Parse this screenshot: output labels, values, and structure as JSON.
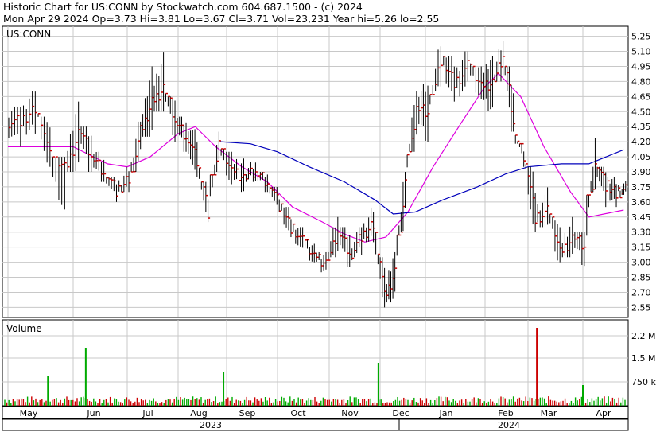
{
  "header": {
    "line1": "Historic Chart for US:CONN by Stockwatch.com 604.687.1500 - (c) 2024",
    "line2": "Mon Apr 29 2024  Op=3.73  Hi=3.81  Lo=3.67  Cl=3.71  Vol=23,231  Year hi=5.26  lo=2.55"
  },
  "price_panel_label": "US:CONN",
  "volume_panel_label": "Volume",
  "chart_data": [
    {
      "type": "bar",
      "subtype": "ohlc",
      "series": [
        {
          "values": [
            {
              "m": "May",
              "d": 1,
              "hi": 4.55,
              "lo": 4.1,
              "c": 4.4
            },
            {
              "m": "May",
              "d": 8,
              "hi": 4.7,
              "lo": 4.25,
              "c": 4.55
            },
            {
              "m": "May",
              "d": 15,
              "hi": 4.45,
              "lo": 3.95,
              "c": 4.05
            },
            {
              "m": "May",
              "d": 22,
              "hi": 4.05,
              "lo": 3.05,
              "c": 3.95
            },
            {
              "m": "May",
              "d": 29,
              "hi": 4.6,
              "lo": 3.9,
              "c": 4.3
            },
            {
              "m": "Jun",
              "d": 5,
              "hi": 4.35,
              "lo": 3.9,
              "c": 4.05
            },
            {
              "m": "Jun",
              "d": 12,
              "hi": 4.1,
              "lo": 3.8,
              "c": 3.9
            },
            {
              "m": "Jun",
              "d": 19,
              "hi": 3.85,
              "lo": 3.6,
              "c": 3.7
            },
            {
              "m": "Jun",
              "d": 26,
              "hi": 3.95,
              "lo": 3.7,
              "c": 3.85
            },
            {
              "m": "Jul",
              "d": 3,
              "hi": 4.4,
              "lo": 3.9,
              "c": 4.3
            },
            {
              "m": "Jul",
              "d": 10,
              "hi": 4.95,
              "lo": 4.25,
              "c": 4.6
            },
            {
              "m": "Jul",
              "d": 17,
              "hi": 5.2,
              "lo": 4.5,
              "c": 4.75
            },
            {
              "m": "Jul",
              "d": 24,
              "hi": 4.65,
              "lo": 4.2,
              "c": 4.4
            },
            {
              "m": "Jul",
              "d": 31,
              "hi": 4.45,
              "lo": 4.1,
              "c": 4.25
            },
            {
              "m": "Aug",
              "d": 7,
              "hi": 4.35,
              "lo": 3.85,
              "c": 4.0
            },
            {
              "m": "Aug",
              "d": 14,
              "hi": 3.8,
              "lo": 3.4,
              "c": 3.5
            },
            {
              "m": "Aug",
              "d": 21,
              "hi": 4.3,
              "lo": 3.9,
              "c": 4.15
            },
            {
              "m": "Aug",
              "d": 28,
              "hi": 4.1,
              "lo": 3.75,
              "c": 3.9
            },
            {
              "m": "Sep",
              "d": 5,
              "hi": 4.05,
              "lo": 3.7,
              "c": 3.85
            },
            {
              "m": "Sep",
              "d": 12,
              "hi": 4.0,
              "lo": 3.8,
              "c": 3.9
            },
            {
              "m": "Sep",
              "d": 19,
              "hi": 3.9,
              "lo": 3.7,
              "c": 3.8
            },
            {
              "m": "Sep",
              "d": 26,
              "hi": 3.75,
              "lo": 3.5,
              "c": 3.55
            },
            {
              "m": "Oct",
              "d": 3,
              "hi": 3.55,
              "lo": 3.25,
              "c": 3.35
            },
            {
              "m": "Oct",
              "d": 10,
              "hi": 3.35,
              "lo": 3.1,
              "c": 3.2
            },
            {
              "m": "Oct",
              "d": 17,
              "hi": 3.2,
              "lo": 3.0,
              "c": 3.05
            },
            {
              "m": "Oct",
              "d": 24,
              "hi": 3.1,
              "lo": 2.9,
              "c": 3.0
            },
            {
              "m": "Oct",
              "d": 31,
              "hi": 3.45,
              "lo": 3.05,
              "c": 3.3
            },
            {
              "m": "Nov",
              "d": 7,
              "hi": 3.35,
              "lo": 2.95,
              "c": 3.1
            },
            {
              "m": "Nov",
              "d": 14,
              "hi": 3.35,
              "lo": 3.05,
              "c": 3.25
            },
            {
              "m": "Nov",
              "d": 21,
              "hi": 3.55,
              "lo": 3.2,
              "c": 3.4
            },
            {
              "m": "Nov",
              "d": 28,
              "hi": 3.05,
              "lo": 2.55,
              "c": 2.65
            },
            {
              "m": "Dec",
              "d": 5,
              "hi": 3.1,
              "lo": 2.6,
              "c": 2.9
            },
            {
              "m": "Dec",
              "d": 12,
              "hi": 3.9,
              "lo": 3.3,
              "c": 3.8
            },
            {
              "m": "Dec",
              "d": 19,
              "hi": 4.7,
              "lo": 4.1,
              "c": 4.55
            },
            {
              "m": "Dec",
              "d": 27,
              "hi": 4.8,
              "lo": 4.2,
              "c": 4.5
            },
            {
              "m": "Jan",
              "d": 3,
              "hi": 5.15,
              "lo": 4.7,
              "c": 5.0
            },
            {
              "m": "Jan",
              "d": 10,
              "hi": 5.05,
              "lo": 4.6,
              "c": 4.8
            },
            {
              "m": "Jan",
              "d": 17,
              "hi": 5.1,
              "lo": 4.65,
              "c": 4.95
            },
            {
              "m": "Jan",
              "d": 24,
              "hi": 4.95,
              "lo": 4.6,
              "c": 4.75
            },
            {
              "m": "Jan",
              "d": 31,
              "hi": 5.05,
              "lo": 4.45,
              "c": 4.8
            },
            {
              "m": "Feb",
              "d": 7,
              "hi": 5.2,
              "lo": 4.8,
              "c": 5.05
            },
            {
              "m": "Feb",
              "d": 14,
              "hi": 4.95,
              "lo": 4.3,
              "c": 4.4
            },
            {
              "m": "Feb",
              "d": 21,
              "hi": 4.15,
              "lo": 3.95,
              "c": 4.05
            },
            {
              "m": "Feb",
              "d": 28,
              "hi": 3.95,
              "lo": 3.3,
              "c": 3.45
            },
            {
              "m": "Mar",
              "d": 6,
              "hi": 3.75,
              "lo": 3.35,
              "c": 3.5
            },
            {
              "m": "Mar",
              "d": 13,
              "hi": 3.45,
              "lo": 3.0,
              "c": 3.1
            },
            {
              "m": "Mar",
              "d": 20,
              "hi": 3.45,
              "lo": 3.05,
              "c": 3.25
            },
            {
              "m": "Mar",
              "d": 27,
              "hi": 3.3,
              "lo": 2.9,
              "c": 3.15
            },
            {
              "m": "Apr",
              "d": 3,
              "hi": 4.25,
              "lo": 3.7,
              "c": 4.0
            },
            {
              "m": "Apr",
              "d": 10,
              "hi": 3.95,
              "lo": 3.55,
              "c": 3.75
            },
            {
              "m": "Apr",
              "d": 17,
              "hi": 3.85,
              "lo": 3.55,
              "c": 3.7
            },
            {
              "m": "Apr",
              "d": 24,
              "hi": 3.81,
              "lo": 3.67,
              "c": 3.71
            }
          ]
        }
      ],
      "y_ticks": [
        5.25,
        5.1,
        4.95,
        4.8,
        4.65,
        4.5,
        4.35,
        4.2,
        4.05,
        3.9,
        3.75,
        3.6,
        3.45,
        3.3,
        3.15,
        3.0,
        2.85,
        2.7,
        2.55
      ],
      "y_tick_labels": [
        "5.25",
        "5.10",
        "4.95",
        "4.80",
        "4.65",
        "4.50",
        "4.35",
        "4.20",
        "4.05",
        "3.90",
        "3.75",
        "3.60",
        "3.45",
        "3.30",
        "3.15",
        "3.00",
        "2.85",
        "2.70",
        "2.55"
      ],
      "ylim": [
        2.45,
        5.35
      ],
      "grid": true,
      "moving_average_1": [
        {
          "m": "May",
          "d": 1,
          "v": 4.15
        },
        {
          "m": "Jun",
          "d": 1,
          "v": 4.15
        },
        {
          "m": "Jun",
          "d": 20,
          "v": 3.98
        },
        {
          "m": "Jul",
          "d": 1,
          "v": 3.95
        },
        {
          "m": "Jul",
          "d": 15,
          "v": 4.05
        },
        {
          "m": "Aug",
          "d": 1,
          "v": 4.28
        },
        {
          "m": "Aug",
          "d": 12,
          "v": 4.35
        },
        {
          "m": "Aug",
          "d": 25,
          "v": 4.15
        },
        {
          "m": "Sep",
          "d": 10,
          "v": 3.95
        },
        {
          "m": "Sep",
          "d": 25,
          "v": 3.8
        },
        {
          "m": "Oct",
          "d": 10,
          "v": 3.55
        },
        {
          "m": "Oct",
          "d": 28,
          "v": 3.4
        },
        {
          "m": "Nov",
          "d": 10,
          "v": 3.28
        },
        {
          "m": "Nov",
          "d": 22,
          "v": 3.2
        },
        {
          "m": "Dec",
          "d": 5,
          "v": 3.25
        },
        {
          "m": "Dec",
          "d": 20,
          "v": 3.5
        },
        {
          "m": "Jan",
          "d": 5,
          "v": 3.95
        },
        {
          "m": "Jan",
          "d": 20,
          "v": 4.4
        },
        {
          "m": "Feb",
          "d": 1,
          "v": 4.75
        },
        {
          "m": "Feb",
          "d": 10,
          "v": 4.88
        },
        {
          "m": "Feb",
          "d": 25,
          "v": 4.65
        },
        {
          "m": "Mar",
          "d": 10,
          "v": 4.15
        },
        {
          "m": "Mar",
          "d": 25,
          "v": 3.7
        },
        {
          "m": "Apr",
          "d": 5,
          "v": 3.45
        },
        {
          "m": "Apr",
          "d": 28,
          "v": 3.52
        }
      ],
      "moving_average_2": [
        {
          "m": "Aug",
          "d": 28,
          "v": 4.2
        },
        {
          "m": "Sep",
          "d": 15,
          "v": 4.18
        },
        {
          "m": "Oct",
          "d": 1,
          "v": 4.1
        },
        {
          "m": "Oct",
          "d": 20,
          "v": 3.95
        },
        {
          "m": "Nov",
          "d": 10,
          "v": 3.8
        },
        {
          "m": "Nov",
          "d": 28,
          "v": 3.62
        },
        {
          "m": "Dec",
          "d": 10,
          "v": 3.48
        },
        {
          "m": "Dec",
          "d": 25,
          "v": 3.5
        },
        {
          "m": "Jan",
          "d": 10,
          "v": 3.62
        },
        {
          "m": "Jan",
          "d": 28,
          "v": 3.75
        },
        {
          "m": "Feb",
          "d": 15,
          "v": 3.88
        },
        {
          "m": "Mar",
          "d": 1,
          "v": 3.95
        },
        {
          "m": "Mar",
          "d": 20,
          "v": 3.98
        },
        {
          "m": "Apr",
          "d": 5,
          "v": 3.98
        },
        {
          "m": "Apr",
          "d": 28,
          "v": 4.12
        }
      ]
    },
    {
      "type": "bar",
      "values_unit": "shares",
      "y_ticks": [
        2200000,
        1500000,
        750000
      ],
      "y_tick_labels": [
        "2.2 M",
        "1.5 M",
        "750 k"
      ],
      "ylim": [
        0,
        2700000
      ],
      "spikes": [
        {
          "m": "May",
          "d": 20,
          "v": 950000
        },
        {
          "m": "Jun",
          "d": 8,
          "v": 1800000
        },
        {
          "m": "Aug",
          "d": 30,
          "v": 1050000
        },
        {
          "m": "Nov",
          "d": 30,
          "v": 1350000
        },
        {
          "m": "Mar",
          "d": 6,
          "v": 2450000
        },
        {
          "m": "Apr",
          "d": 1,
          "v": 650000
        }
      ]
    }
  ],
  "x_axis": {
    "month_labels": [
      "May",
      "Jun",
      "Jul",
      "Aug",
      "Sep",
      "Oct",
      "Nov",
      "Dec",
      "Jan",
      "Feb",
      "Mar",
      "Apr"
    ],
    "year_labels": [
      "2023",
      "2024"
    ]
  },
  "colors": {
    "bar": "#000000",
    "close_tick": "#cc0000",
    "ma1": "#dd00dd",
    "ma2": "#0000bb",
    "vol_up": "#00aa00",
    "vol_down": "#cc0000",
    "grid": "#c8c8c8"
  }
}
